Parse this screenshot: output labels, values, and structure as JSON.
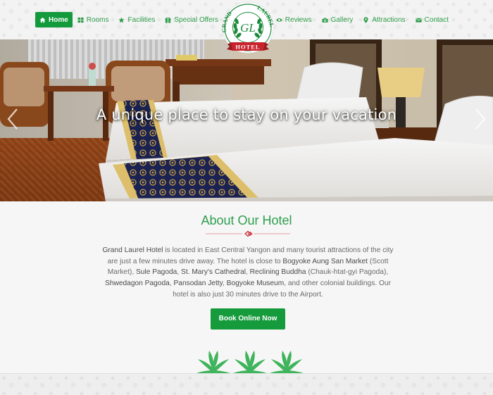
{
  "colors": {
    "brand_green": "#139a3c",
    "text_green": "#2f9d4b",
    "accent_red": "#c8232c"
  },
  "nav_left": [
    {
      "label": "Home",
      "icon": "home-icon",
      "active": true
    },
    {
      "label": "Rooms",
      "icon": "grid-icon",
      "active": false
    },
    {
      "label": "Facilities",
      "icon": "star-icon",
      "active": false
    },
    {
      "label": "Special Offers",
      "icon": "gift-icon",
      "active": false
    }
  ],
  "nav_right": [
    {
      "label": "Reviews",
      "icon": "eye-icon"
    },
    {
      "label": "Gallery",
      "icon": "camera-icon"
    },
    {
      "label": "Attractions",
      "icon": "map-marker-icon"
    },
    {
      "label": "Contact",
      "icon": "envelope-icon"
    }
  ],
  "logo": {
    "monogram": "GL",
    "top_left": "GRAND",
    "top_right": "LAUREL",
    "ribbon": "HOTEL"
  },
  "hero": {
    "caption": "A unique place to stay on your vacation"
  },
  "about": {
    "title": "About Our Hotel",
    "paragraph": [
      {
        "text": "Grand Laurel Hotel",
        "strong": true
      },
      {
        "text": " is located in East Central Yangon and many tourist attractions of the city are just a few minutes drive away. The hotel is close to ",
        "strong": false
      },
      {
        "text": "Bogyoke Aung San Market",
        "strong": true
      },
      {
        "text": " (Scott Market), ",
        "strong": false
      },
      {
        "text": "Sule Pagoda",
        "strong": true
      },
      {
        "text": ", ",
        "strong": false
      },
      {
        "text": "St. Mary's Cathedral",
        "strong": true
      },
      {
        "text": ", ",
        "strong": false
      },
      {
        "text": "Reclining Buddha",
        "strong": true
      },
      {
        "text": " (Chauk-htat-gyi Pagoda), ",
        "strong": false
      },
      {
        "text": "Shwedagon Pagoda",
        "strong": true
      },
      {
        "text": ", ",
        "strong": false
      },
      {
        "text": "Pansodan Jetty",
        "strong": true
      },
      {
        "text": ", ",
        "strong": false
      },
      {
        "text": "Bogyoke Museum",
        "strong": true
      },
      {
        "text": ", and other colonial buildings. Our hotel is also just 30 minutes drive to the Airport.",
        "strong": false
      }
    ],
    "button_label": "Book Online Now"
  }
}
